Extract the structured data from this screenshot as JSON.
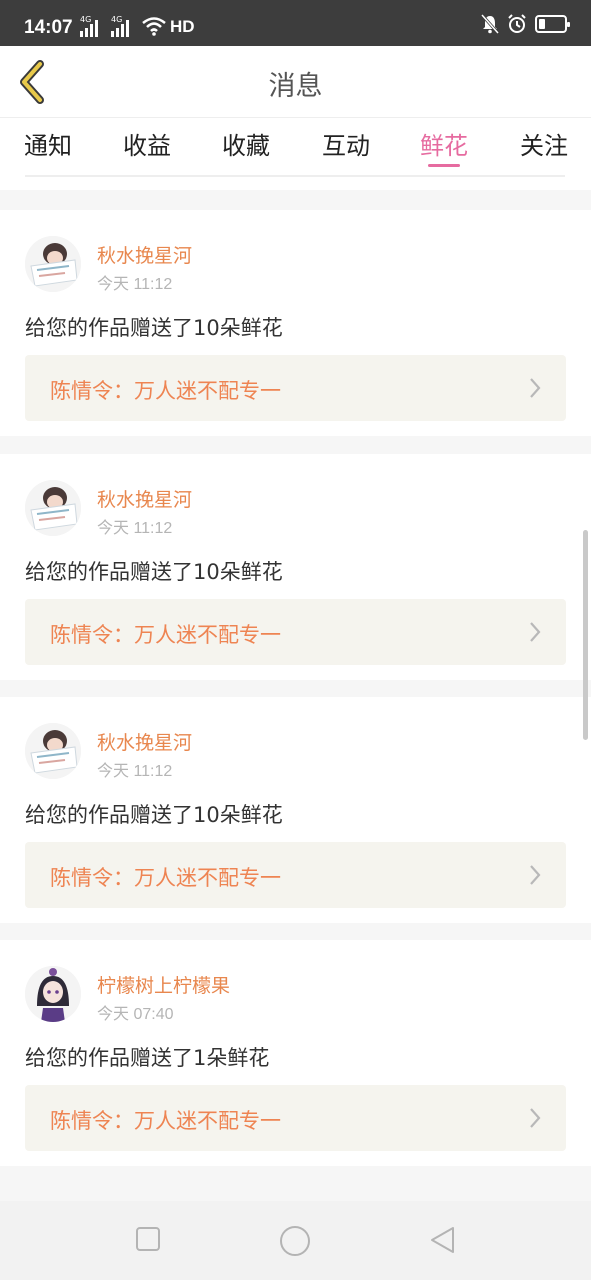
{
  "status_bar": {
    "time": "14:07",
    "network1": "4G",
    "network2": "4G",
    "hd": "HD",
    "battery_level": 0.25
  },
  "header": {
    "title": "消息"
  },
  "tabs": [
    {
      "label": "通知",
      "active": false
    },
    {
      "label": "收益",
      "active": false
    },
    {
      "label": "收藏",
      "active": false
    },
    {
      "label": "互动",
      "active": false
    },
    {
      "label": "鲜花",
      "active": true
    },
    {
      "label": "关注",
      "active": false
    }
  ],
  "messages": [
    {
      "user": "秋水挽星河",
      "time": "今天 11:12",
      "text": "给您的作品赠送了10朵鲜花",
      "work": "陈情令：万人迷不配专一"
    },
    {
      "user": "秋水挽星河",
      "time": "今天 11:12",
      "text": "给您的作品赠送了10朵鲜花",
      "work": "陈情令：万人迷不配专一"
    },
    {
      "user": "秋水挽星河",
      "time": "今天 11:12",
      "text": "给您的作品赠送了10朵鲜花",
      "work": "陈情令：万人迷不配专一"
    },
    {
      "user": "柠檬树上柠檬果",
      "time": "今天 07:40",
      "text": "给您的作品赠送了1朵鲜花",
      "work": "陈情令：万人迷不配专一"
    }
  ],
  "colors": {
    "accent": "#e66ba0",
    "username": "#e8874e",
    "work_title": "#ee8452",
    "back_arrow": "#e8c94a"
  }
}
